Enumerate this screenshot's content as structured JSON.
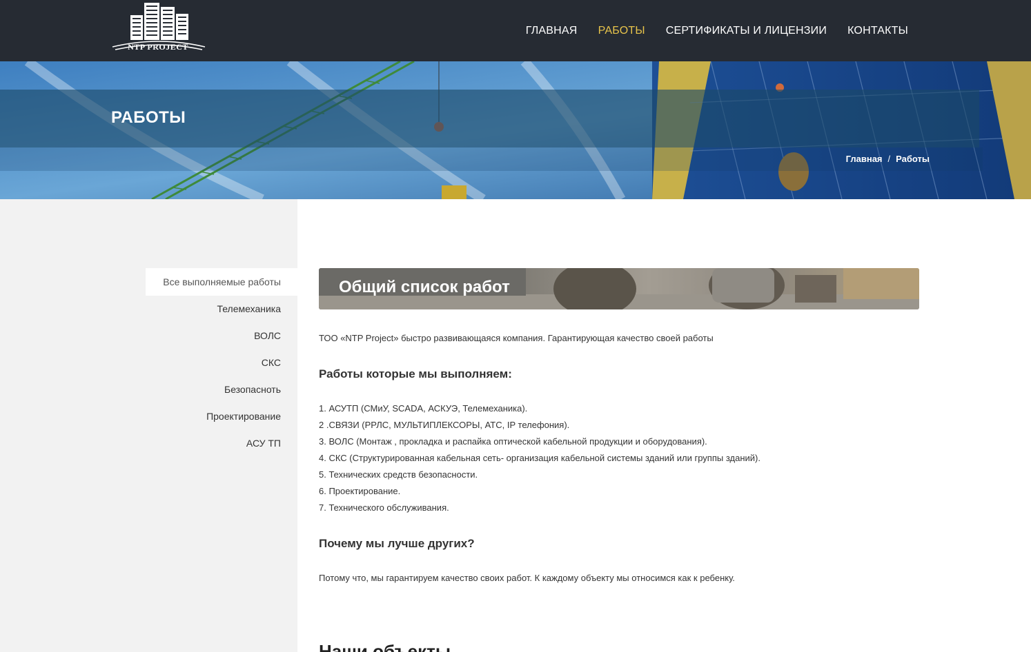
{
  "header": {
    "logo_text": "NTP PROJECT",
    "nav": [
      {
        "label": "ГЛАВНАЯ",
        "active": false
      },
      {
        "label": "РАБОТЫ",
        "active": true
      },
      {
        "label": "СЕРТИФИКАТЫ И ЛИЦЕНЗИИ",
        "active": false
      },
      {
        "label": "КОНТАКТЫ",
        "active": false
      }
    ],
    "accent_color": "#e8c44b",
    "bg_color": "#262b33"
  },
  "hero": {
    "title": "РАБОТЫ",
    "breadcrumb": {
      "home": "Главная",
      "separator": "/",
      "current": "Работы"
    }
  },
  "sidebar": {
    "items": [
      {
        "label": "Все выполняемые работы",
        "active": true
      },
      {
        "label": "Телемеханика",
        "active": false
      },
      {
        "label": "ВОЛС",
        "active": false
      },
      {
        "label": "СКС",
        "active": false
      },
      {
        "label": "Безопасноть",
        "active": false
      },
      {
        "label": "Проектирование",
        "active": false
      },
      {
        "label": "АСУ ТП",
        "active": false
      }
    ]
  },
  "main": {
    "banner_title": "Общий список работ",
    "intro": "ТОО «NTP Project» быстро развивающаяся компания. Гарантирующая качество своей работы",
    "works_heading": "Работы которые мы выполняем:",
    "works": [
      "1. АСУТП (СМиУ, SCADA, АСКУЭ, Телемеханика).",
      "2 .СВЯЗИ (РРЛС, МУЛЬТИПЛЕКСОРЫ, АТС, IP телефония).",
      "3. ВОЛС (Монтаж , прокладка и распайка оптической кабельной продукции и оборудования).",
      "4. СКС (Структурированная кабельная сеть- организация кабельной системы зданий или группы зданий).",
      "5. Технических средств безопасности.",
      "6. Проектирование.",
      "7. Технического обслуживания."
    ],
    "why_heading": "Почему мы лучше других?",
    "why_text": "Потому что, мы гарантируем качество своих работ. К каждому объекту мы относимся как к ребенку.",
    "next_heading_partial": "Наши объекты"
  }
}
